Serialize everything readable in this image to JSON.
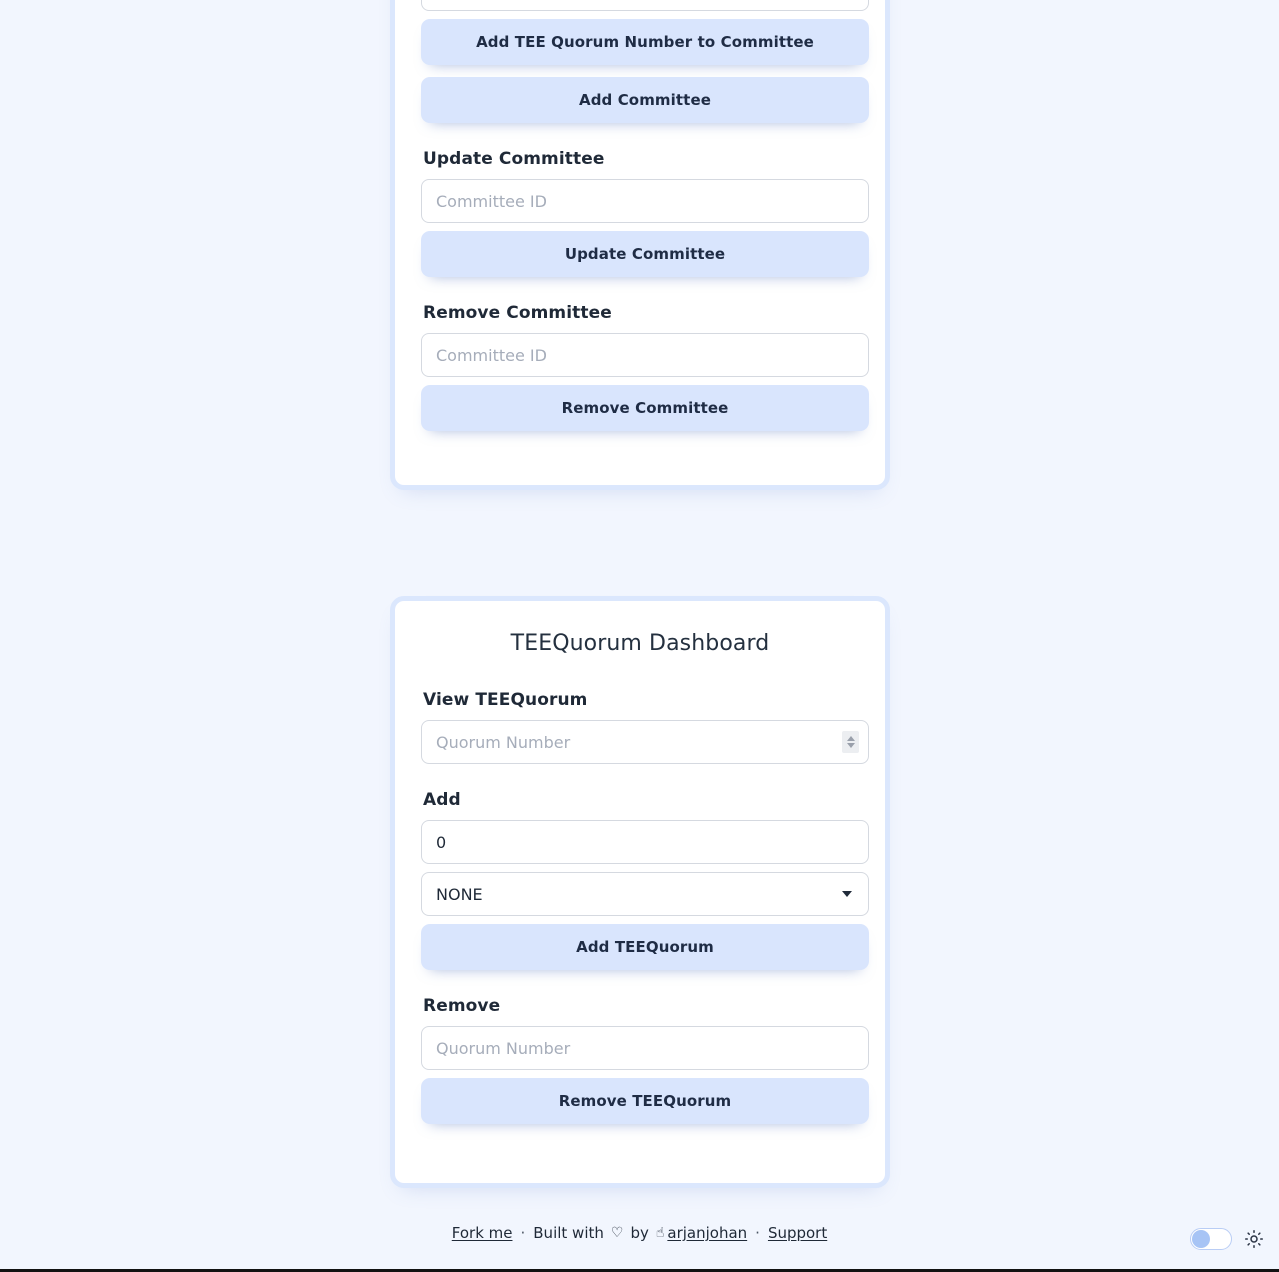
{
  "page": {
    "background_color": "#f2f6fe",
    "accent_color": "#d9e5fd",
    "text_color": "#1f2937"
  },
  "committee_card": {
    "top_input": {
      "placeholder": "",
      "value": ""
    },
    "buttons": {
      "add_tee_quorum_number": "Add TEE Quorum Number to Committee",
      "add_committee": "Add Committee"
    },
    "update_section": {
      "title": "Update Committee",
      "input_placeholder": "Committee ID",
      "button_label": "Update Committee"
    },
    "remove_section": {
      "title": "Remove Committee",
      "input_placeholder": "Committee ID",
      "button_label": "Remove Committee"
    }
  },
  "teequorum_card": {
    "title": "TEEQuorum Dashboard",
    "view_section": {
      "title": "View TEEQuorum",
      "input_placeholder": "Quorum Number"
    },
    "add_section": {
      "title": "Add",
      "number_value": "0",
      "select_value": "NONE",
      "select_options": [
        "NONE"
      ],
      "button_label": "Add TEEQuorum"
    },
    "remove_section": {
      "title": "Remove",
      "input_placeholder": "Quorum Number",
      "button_label": "Remove TEEQuorum"
    }
  },
  "footer": {
    "fork_me": "Fork me",
    "separator": "·",
    "built_with": "Built with",
    "heart": "♡",
    "by": "by",
    "hand_icon": "☝",
    "author": "arjanjohan",
    "support": "Support"
  },
  "theme_toggle": {
    "state": "light",
    "sun_icon": "sun-icon"
  }
}
